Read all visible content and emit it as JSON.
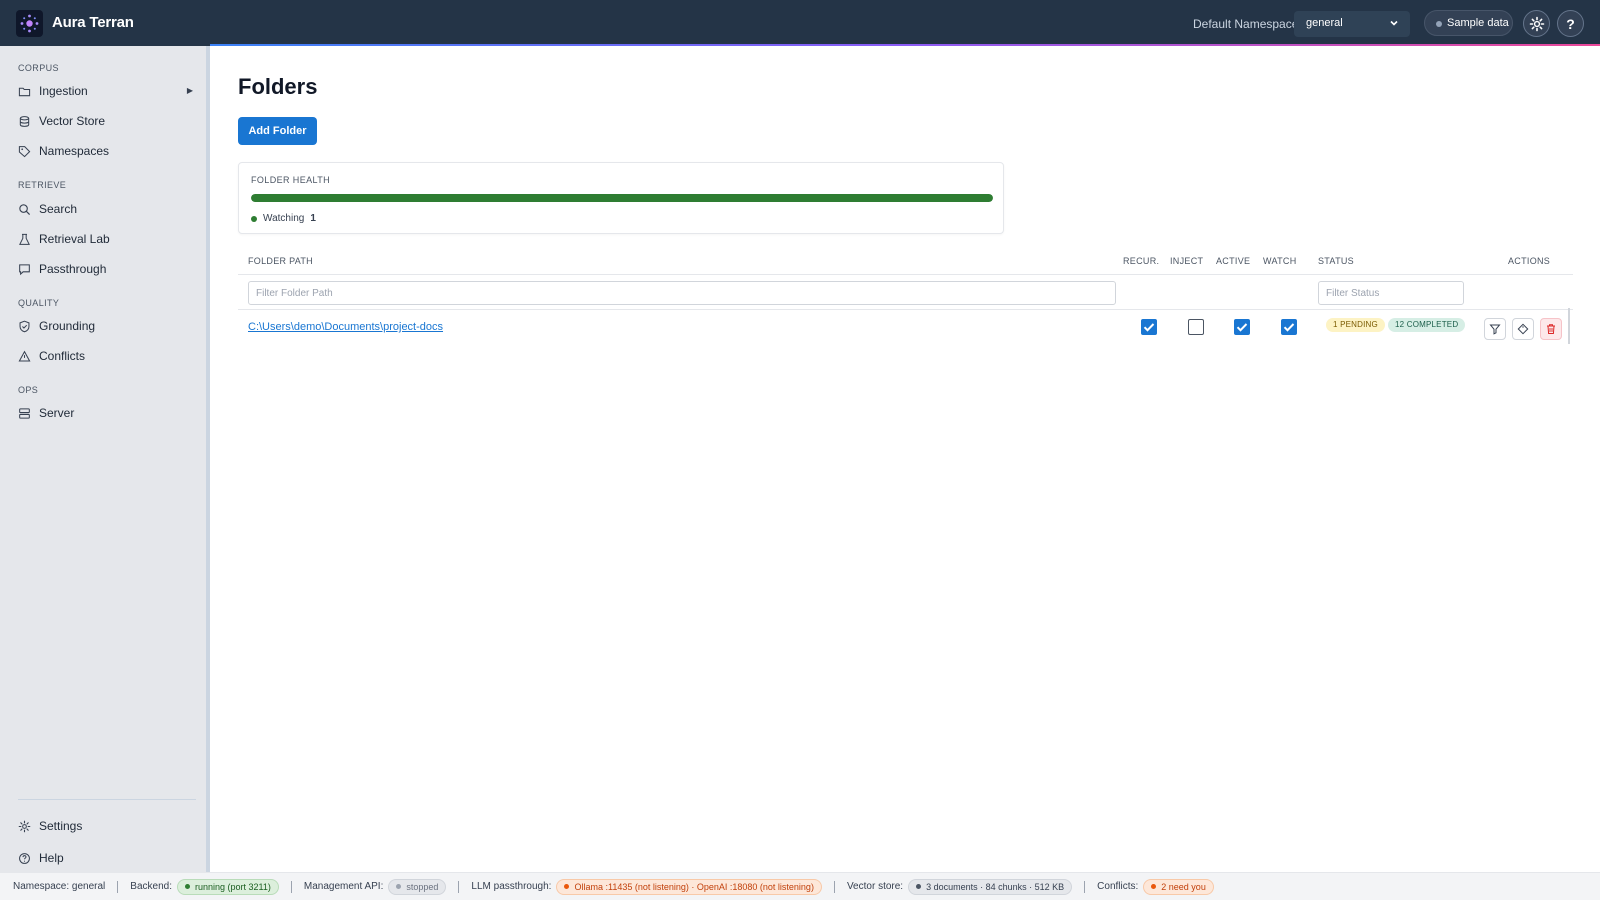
{
  "app": {
    "brand": "Aura Terran"
  },
  "topbar": {
    "namespace_label": "Default Namespace",
    "namespace_value": "general",
    "sample_data_label": "Sample data",
    "help_glyph": "?"
  },
  "sidebar": {
    "sections": [
      {
        "label": "CORPUS",
        "items": [
          {
            "label": "Ingestion",
            "icon": "folder-icon",
            "expandable": true
          },
          {
            "label": "Vector Store",
            "icon": "database-icon"
          },
          {
            "label": "Namespaces",
            "icon": "tag-icon"
          }
        ]
      },
      {
        "label": "RETRIEVE",
        "items": [
          {
            "label": "Search",
            "icon": "search-icon"
          },
          {
            "label": "Retrieval Lab",
            "icon": "flask-icon"
          },
          {
            "label": "Passthrough",
            "icon": "message-icon"
          }
        ]
      },
      {
        "label": "QUALITY",
        "items": [
          {
            "label": "Grounding",
            "icon": "shield-check-icon"
          },
          {
            "label": "Conflicts",
            "icon": "warning-icon"
          }
        ]
      },
      {
        "label": "OPS",
        "items": [
          {
            "label": "Server",
            "icon": "server-icon"
          }
        ]
      }
    ],
    "footer": [
      {
        "label": "Settings",
        "icon": "gear-icon"
      },
      {
        "label": "Help",
        "icon": "help-circle-icon"
      }
    ]
  },
  "main": {
    "title": "Folders",
    "add_button": "Add Folder",
    "health": {
      "title": "FOLDER HEALTH",
      "watching_label": "Watching",
      "watching_count": "1",
      "healthy_fraction": 1.0,
      "color": "#2e7d32"
    },
    "table": {
      "columns": {
        "path": "FOLDER PATH",
        "recur": "RECUR.",
        "inject": "INJECT",
        "active": "ACTIVE",
        "watch": "WATCH",
        "status": "STATUS",
        "actions": "ACTIONS"
      },
      "filters": {
        "path_placeholder": "Filter Folder Path",
        "status_placeholder": "Filter Status"
      },
      "rows": [
        {
          "path": "C:\\Users\\demo\\Documents\\project-docs",
          "recursive": true,
          "inject": false,
          "active": true,
          "watch": true,
          "pending_badge": "1 PENDING",
          "completed_badge": "12 COMPLETED"
        }
      ]
    }
  },
  "statusbar": {
    "namespace": "Namespace: general",
    "backend_label": "Backend:",
    "backend_value": "running (port 3211)",
    "mgmt_label": "Management API:",
    "mgmt_value": "stopped",
    "llm_label": "LLM passthrough:",
    "llm_value": "Ollama :11435 (not listening) · OpenAI :18080 (not listening)",
    "vector_label": "Vector store:",
    "vector_value": "3 documents · 84 chunks · 512 KB",
    "conflicts_label": "Conflicts:",
    "conflicts_value": "2 need you"
  },
  "colors": {
    "topbar": "#243447",
    "accent": "#1976d2",
    "health": "#2e7d32",
    "warning": "#ea580c"
  }
}
